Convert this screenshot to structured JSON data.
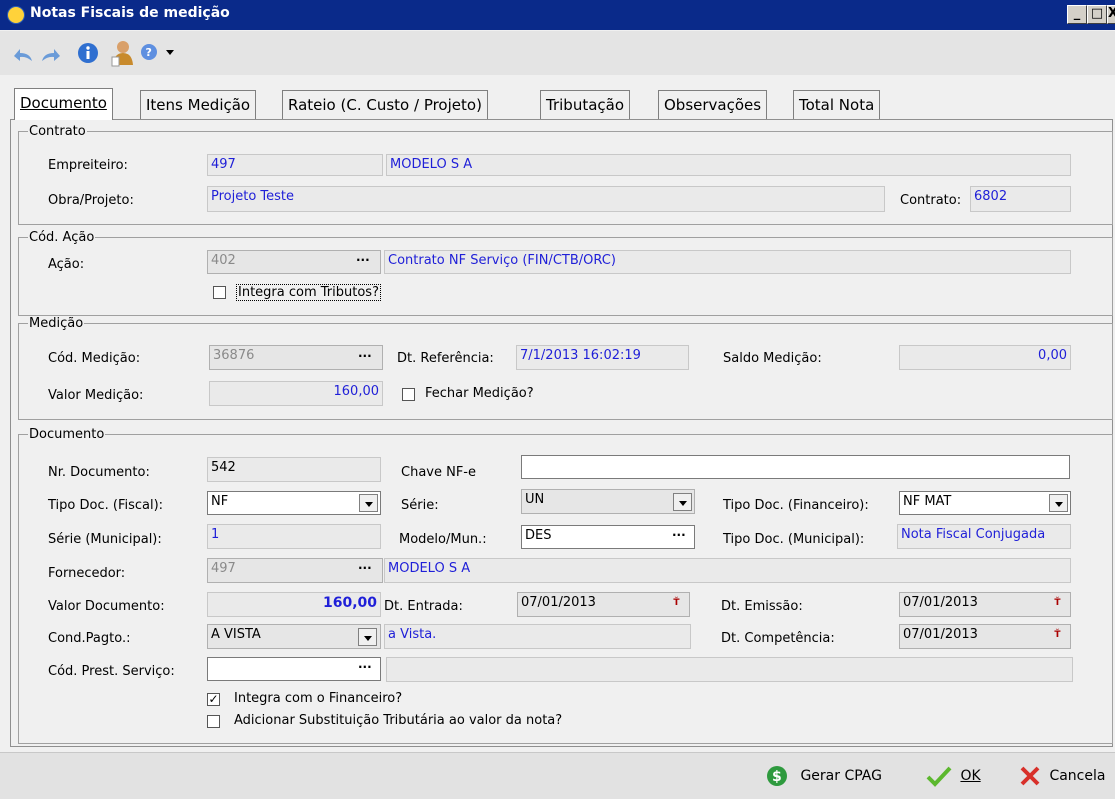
{
  "window": {
    "title": "Notas Fiscais de medição"
  },
  "tabs": [
    "Documento",
    "Itens Medição",
    "Rateio (C. Custo / Projeto)",
    "Tributação",
    "Observações",
    "Total Nota"
  ],
  "contrato": {
    "legend": "Contrato",
    "empreiteiro_label": "Empreiteiro:",
    "empreiteiro_code": "497",
    "empreiteiro_name": "MODELO S A",
    "obra_label": "Obra/Projeto:",
    "obra_value": "Projeto Teste",
    "contrato_label": "Contrato:",
    "contrato_value": "6802"
  },
  "acao": {
    "legend": "Cód. Ação",
    "acao_label": "Ação:",
    "acao_code": "402",
    "acao_desc": "Contrato NF Serviço (FIN/CTB/ORC)",
    "integra_tributos": "Integra com Tributos?"
  },
  "medicao": {
    "legend": "Medição",
    "cod_label": "Cód. Medição:",
    "cod_value": "36876",
    "dtref_label": "Dt. Referência:",
    "dtref_value": "7/1/2013 16:02:19",
    "saldo_label": "Saldo Medição:",
    "saldo_value": "0,00",
    "valor_label": "Valor Medição:",
    "valor_value": "160,00",
    "fechar_label": "Fechar Medição?"
  },
  "documento": {
    "legend": "Documento",
    "nr_label": "Nr. Documento:",
    "nr_value": "542",
    "chave_label": "Chave NF-e",
    "chave_value": "",
    "tipo_fiscal_label": "Tipo Doc. (Fiscal):",
    "tipo_fiscal_value": "NF",
    "serie_label": "Série:",
    "serie_value": "UN",
    "tipo_fin_label": "Tipo Doc. (Financeiro):",
    "tipo_fin_value": "NF MAT",
    "serie_mun_label": "Série (Municipal):",
    "serie_mun_value": "1",
    "modelo_label": "Modelo/Mun.:",
    "modelo_value": "DES",
    "tipo_mun_label": "Tipo Doc. (Municipal):",
    "tipo_mun_value": "Nota Fiscal Conjugada",
    "fornecedor_label": "Fornecedor:",
    "fornecedor_code": "497",
    "fornecedor_name": "MODELO S A",
    "valor_label": "Valor Documento:",
    "valor_value": "160,00",
    "dtentrada_label": "Dt. Entrada:",
    "dtentrada_value": "07/01/2013",
    "dtemissao_label": "Dt. Emissão:",
    "dtemissao_value": "07/01/2013",
    "cond_label": "Cond.Pagto.:",
    "cond_value": "A VISTA",
    "cond_desc": "a Vista.",
    "dtcomp_label": "Dt. Competência:",
    "dtcomp_value": "07/01/2013",
    "prest_label": "Cód. Prest. Serviço:",
    "prest_value": "",
    "integra_fin": "Integra com o Financeiro?",
    "integra_fin_checked": true,
    "subst_trib": "Adicionar Substituição Tributária ao valor da nota?",
    "subst_trib_checked": false
  },
  "footer": {
    "gerar": "Gerar CPAG",
    "ok": "OK",
    "cancela": "Cancela"
  }
}
